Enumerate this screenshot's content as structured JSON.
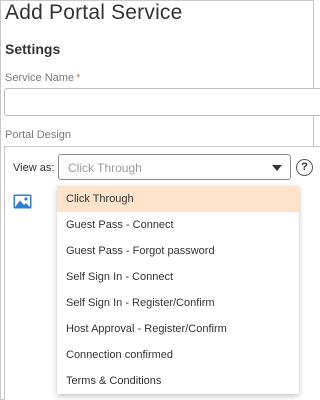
{
  "header": {
    "title": "Add Portal Service"
  },
  "settings": {
    "section_title": "Settings",
    "service_name": {
      "label": "Service Name",
      "required_marker": "*",
      "value": ""
    }
  },
  "portal_design": {
    "label": "Portal Design",
    "view_as_label": "View as:",
    "selected": "Click Through",
    "help_icon_text": "?",
    "options": [
      "Click Through",
      "Guest Pass - Connect",
      "Guest Pass - Forgot password",
      "Self Sign In - Connect",
      "Self Sign In - Register/Confirm",
      "Host Approval - Register/Confirm",
      "Connection confirmed",
      "Terms & Conditions"
    ]
  },
  "colors": {
    "accent_required": "#e07a3a",
    "selected_option_bg": "#fde3c9",
    "image_icon": "#2f7fd1"
  }
}
